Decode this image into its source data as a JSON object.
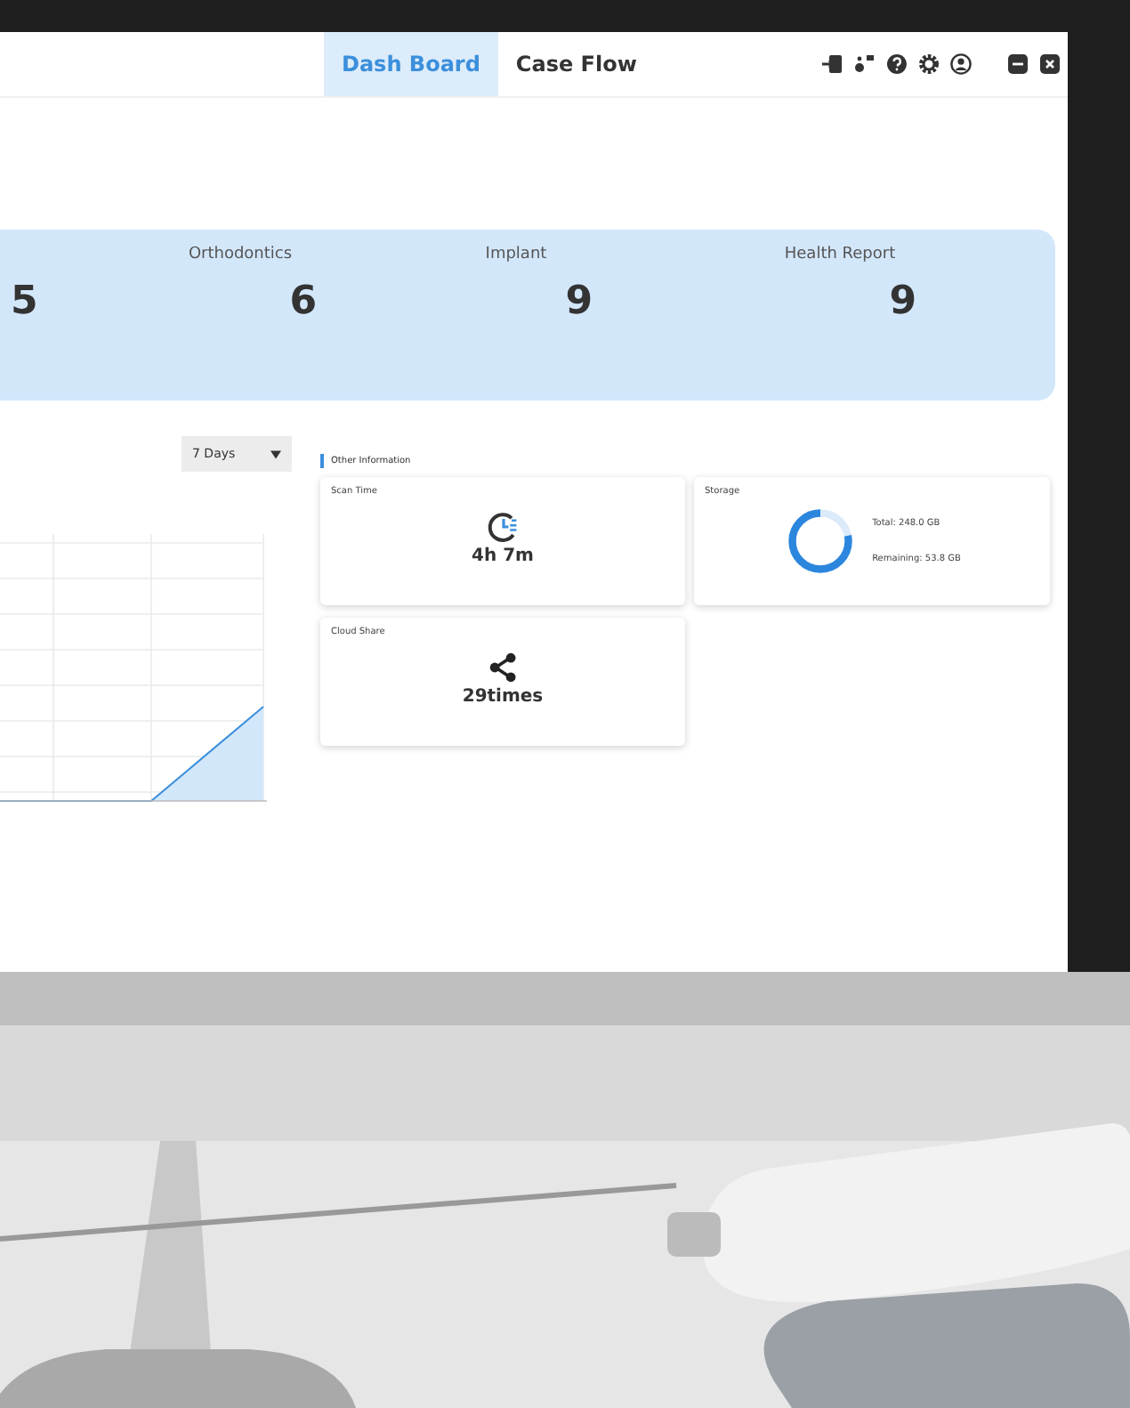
{
  "tabs": [
    {
      "label": "Dash Board",
      "selected": true
    },
    {
      "label": "Case Flow",
      "selected": false
    }
  ],
  "stats": [
    {
      "value": "5"
    },
    {
      "label": "Orthodontics",
      "value": "6"
    },
    {
      "label": "Implant",
      "value": "9"
    },
    {
      "label": "Health Report",
      "value": "9"
    }
  ],
  "range_select": {
    "value": "7 Days"
  },
  "other_information": {
    "title": "Other Information",
    "scan_time": {
      "title": "Scan Time",
      "value": "4h 7m"
    },
    "storage": {
      "title": "Storage",
      "level": 0.78,
      "total": "Total: 248.0 GB",
      "remaining": "Remaining: 53.8 GB"
    },
    "cloud_share": {
      "title": "Cloud Share",
      "value": "29times"
    }
  }
}
